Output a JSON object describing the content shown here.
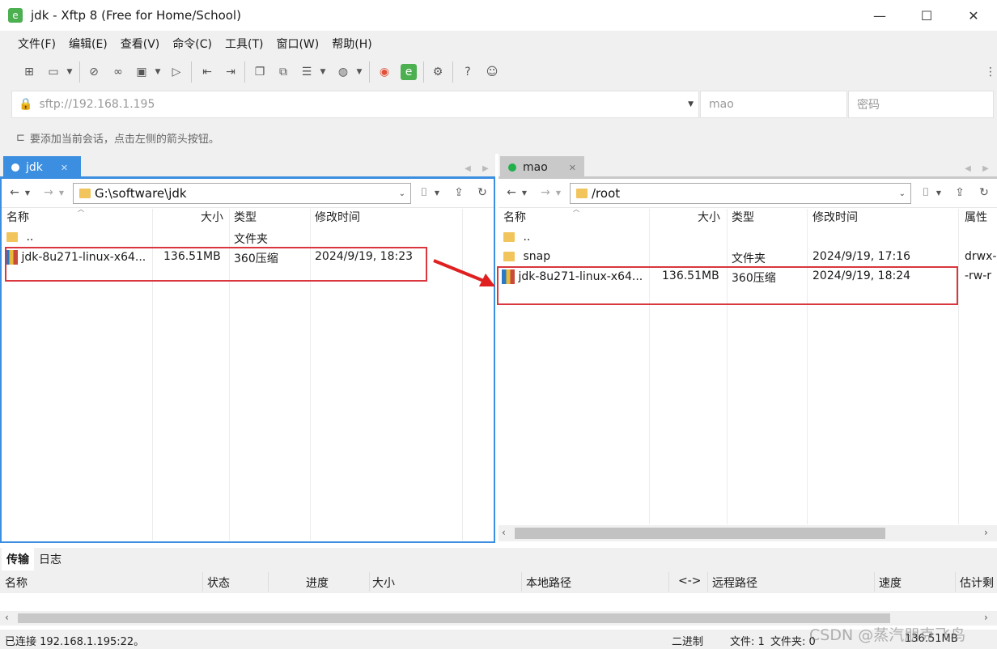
{
  "window": {
    "title": "jdk - Xftp 8 (Free for Home/School)",
    "minimize": "—",
    "maximize": "☐",
    "close": "✕"
  },
  "menu": [
    "文件(F)",
    "编辑(E)",
    "查看(V)",
    "命令(C)",
    "工具(T)",
    "窗口(W)",
    "帮助(H)"
  ],
  "address": {
    "url": "sftp://192.168.1.195",
    "user": "mao",
    "password_placeholder": "密码"
  },
  "hint": "要添加当前会话，点击左侧的箭头按钮。",
  "left": {
    "tab": "jdk",
    "path": "G:\\software\\jdk",
    "columns": [
      "名称",
      "大小",
      "类型",
      "修改时间"
    ],
    "rows": [
      {
        "name": "..",
        "size": "",
        "type": "文件夹",
        "modified": ""
      },
      {
        "name": "jdk-8u271-linux-x64...",
        "size": "136.51MB",
        "type": "360压缩",
        "modified": "2024/9/19, 18:23"
      }
    ]
  },
  "right": {
    "tab": "mao",
    "path": "/root",
    "columns": [
      "名称",
      "大小",
      "类型",
      "修改时间",
      "属性"
    ],
    "rows": [
      {
        "name": "..",
        "size": "",
        "type": "",
        "modified": "",
        "attr": ""
      },
      {
        "name": "snap",
        "size": "",
        "type": "文件夹",
        "modified": "2024/9/19, 17:16",
        "attr": "drwx-"
      },
      {
        "name": "jdk-8u271-linux-x64...",
        "size": "136.51MB",
        "type": "360压缩",
        "modified": "2024/9/19, 18:24",
        "attr": "-rw-r"
      }
    ]
  },
  "bottom": {
    "tabs": [
      "传输",
      "日志"
    ],
    "columns": [
      "名称",
      "状态",
      "进度",
      "大小",
      "本地路径",
      "<->",
      "远程路径",
      "速度",
      "估计剩"
    ]
  },
  "status": {
    "connection": "已连接 192.168.1.195:22。",
    "mode": "二进制",
    "files": "文件: 1",
    "folders": "文件夹: 0",
    "size": "136.51MB",
    "watermark": "CSDN @蒸汽朋克飞鸟"
  },
  "colors": {
    "accent": "#3b8ee0",
    "highlight": "#d9363e",
    "connected": "#22b04a"
  }
}
